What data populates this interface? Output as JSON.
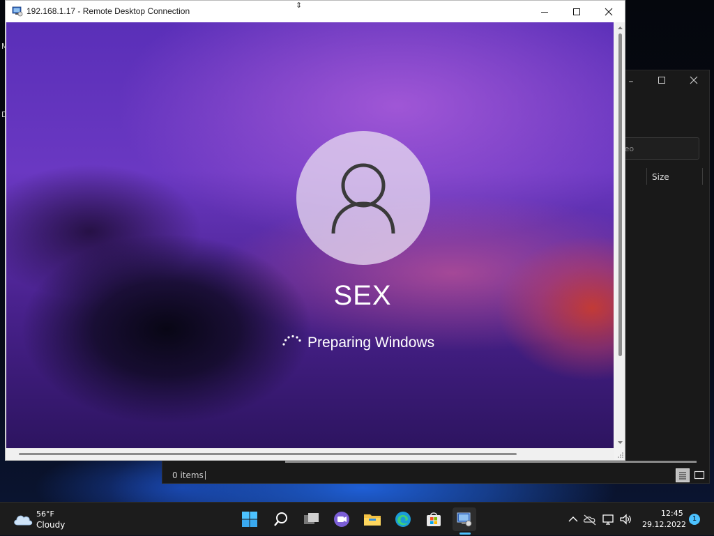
{
  "desktop": {
    "edge_letters": [
      "M",
      "D"
    ]
  },
  "explorer": {
    "search_placeholder": "део",
    "column_size": "Size",
    "status_items": "0 items"
  },
  "rdp": {
    "title": "192.168.1.17 - Remote Desktop Connection",
    "remote": {
      "username": "SEX",
      "status": "Preparing Windows"
    }
  },
  "taskbar": {
    "weather": {
      "temp": "56°F",
      "condition": "Cloudy"
    },
    "apps": [
      "start-icon",
      "search-icon",
      "task-view-icon",
      "teams-chat-icon",
      "file-explorer-icon",
      "edge-icon",
      "store-icon",
      "remote-desktop-icon"
    ],
    "clock": {
      "time": "12:45",
      "date": "29.12.2022"
    },
    "notification_count": "1"
  }
}
